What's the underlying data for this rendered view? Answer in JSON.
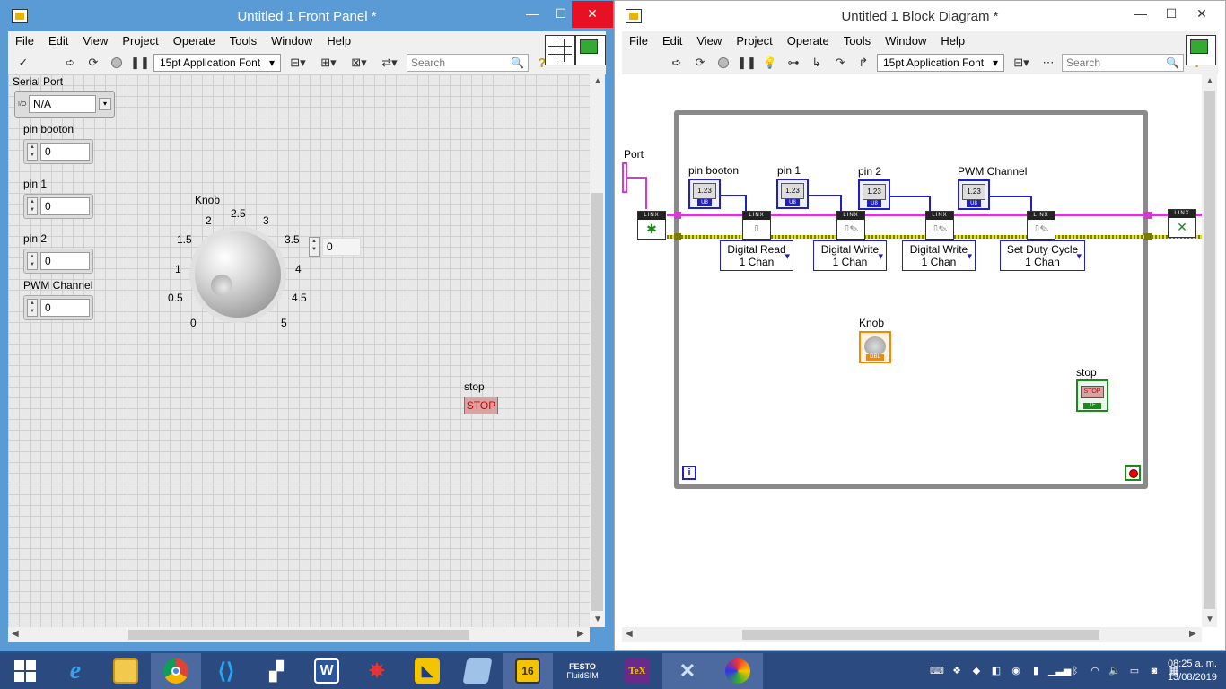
{
  "front_panel": {
    "title": "Untitled 1 Front Panel *",
    "menu": [
      "File",
      "Edit",
      "View",
      "Project",
      "Operate",
      "Tools",
      "Window",
      "Help"
    ],
    "font": "15pt Application Font",
    "search_placeholder": "Search",
    "controls": {
      "serial_port": {
        "label": "Serial Port",
        "value": "N/A",
        "ring_prefix": "I/O"
      },
      "pin_booton": {
        "label": "pin booton",
        "value": "0"
      },
      "pin_1": {
        "label": "pin 1",
        "value": "0"
      },
      "pin_2": {
        "label": "pin 2",
        "value": "0"
      },
      "pwm_channel": {
        "label": "PWM Channel",
        "value": "0"
      },
      "knob": {
        "label": "Knob",
        "value": "0",
        "ticks": [
          "0",
          "0.5",
          "1",
          "1.5",
          "2",
          "2.5",
          "3",
          "3.5",
          "4",
          "4.5",
          "5"
        ]
      },
      "stop": {
        "label": "stop",
        "button_text": "STOP"
      }
    }
  },
  "block_diagram": {
    "title": "Untitled 1 Block Diagram *",
    "menu": [
      "File",
      "Edit",
      "View",
      "Project",
      "Operate",
      "Tools",
      "Window",
      "Help"
    ],
    "font": "15pt Application Font",
    "search_placeholder": "Search",
    "port_label": "Port",
    "terminals": {
      "pin_booton": "pin booton",
      "pin_1": "pin 1",
      "pin_2": "pin 2",
      "pwm_channel": "PWM Channel",
      "knob": "Knob",
      "stop": "stop",
      "u8_text": "1.23",
      "u8_tag": "U8",
      "dbl_tag": "DBL",
      "tf_tag": "TF",
      "stop_face": "STOP"
    },
    "linx_header": "LINX",
    "nodes": [
      {
        "line1": "Digital Read",
        "line2": "1 Chan"
      },
      {
        "line1": "Digital Write",
        "line2": "1 Chan"
      },
      {
        "line1": "Digital Write",
        "line2": "1 Chan"
      },
      {
        "line1": "Set Duty Cycle",
        "line2": "1 Chan"
      }
    ],
    "iteration_terminal": "i"
  },
  "taskbar": {
    "time": "08:25 a. m.",
    "date": "13/08/2019",
    "apps": [
      "start",
      "internet-explorer",
      "file-explorer",
      "chrome",
      "visual-studio-code",
      "notepad",
      "word",
      "spider-app",
      "app-blue",
      "app-tablet",
      "labview",
      "festo-fluidsim",
      "tex",
      "app-x",
      "paint"
    ],
    "festo_line1": "FESTO",
    "festo_line2": "FluidSIM",
    "labview_badge": "16",
    "word_letter": "W",
    "tex_text": "TeX"
  },
  "colors": {
    "titlebar_active": "#5b9bd5",
    "close_button": "#e81123",
    "wire_pink": "#d33ad3",
    "wire_blue": "#2020c0",
    "knob_orange": "#f08a00",
    "bool_green": "#1a8a1a",
    "taskbar": "#2b4a80"
  }
}
